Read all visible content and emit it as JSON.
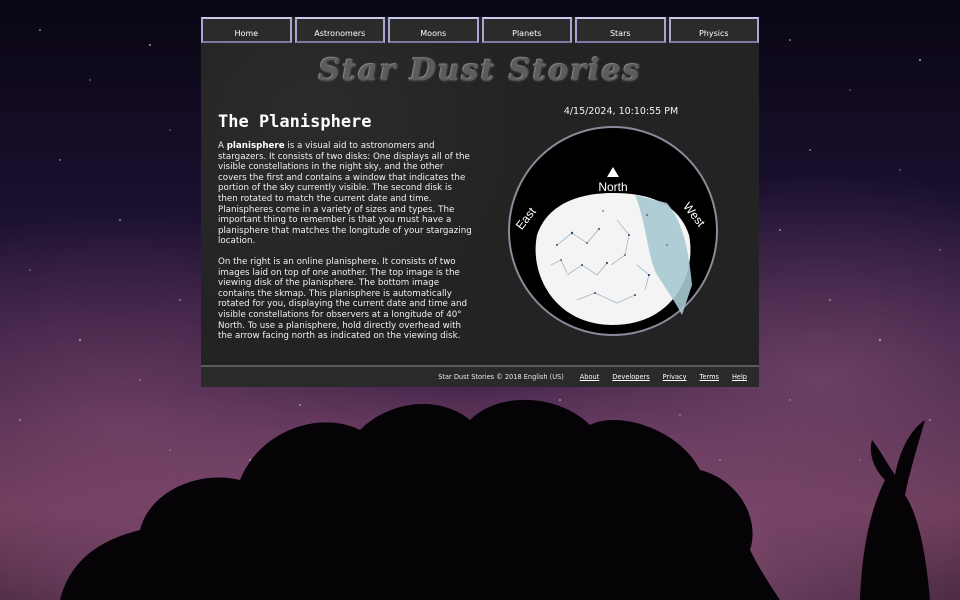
{
  "nav": [
    "Home",
    "Astronomers",
    "Moons",
    "Planets",
    "Stars",
    "Physics"
  ],
  "logo": "Star Dust Stories",
  "article": {
    "title": "The Planisphere",
    "p1_term": "planisphere",
    "p1_before": "A ",
    "p1_after": " is a visual aid to astronomers and stargazers. It consists of two disks: One displays all of the visible constellations in the night sky, and the other covers the first and contains a window that indicates the portion of the sky currently visible. The second disk is then rotated to match the current date and time. Planispheres come in a variety of sizes and types. The important thing to remember is that you must have a planisphere that matches the longitude of your stargazing location.",
    "p2": "On the right is an online planisphere. It consists of two images laid on top of one another. The top image is the viewing disk of the                planisphere. The bottom image contains the skmap. This planisphere is automatically rotated for you, displaying the current date and time and visible constellations for observers at a longitude of 40° North. To use a planisphere, hold directly overhead with the arrow facing north as indicated on the viewing disk."
  },
  "datetime": "4/15/2024, 10:10:55 PM",
  "planisphere": {
    "north": "North",
    "east": "East",
    "west": "West"
  },
  "footer": {
    "copyright": "Star Dust Stories © 2018 English (US)",
    "links": [
      "About",
      "Developers",
      "Privacy",
      "Terms",
      "Help"
    ]
  },
  "colors": {
    "panel": "#232323",
    "nav_border": "#a7a7d4",
    "milky_way": "#a8c9d3"
  }
}
